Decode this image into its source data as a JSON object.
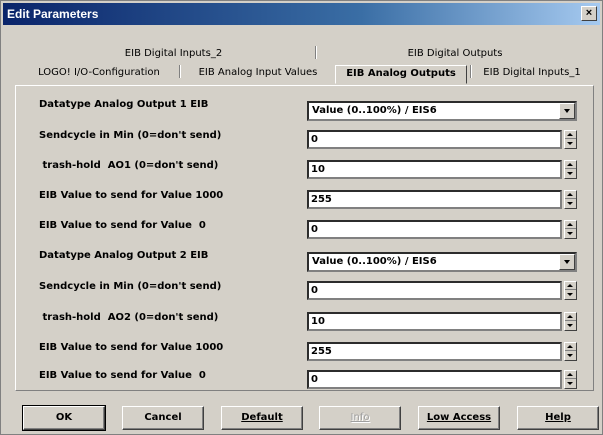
{
  "window": {
    "title": "Edit Parameters",
    "close_glyph": "×"
  },
  "tabs_back": [
    {
      "label": "EIB Digital Inputs_2"
    },
    {
      "label": "EIB Digital Outputs"
    }
  ],
  "tabs_front": [
    {
      "label": "LOGO! I/O-Configuration"
    },
    {
      "label": "EIB Analog Input Values"
    },
    {
      "label": "EIB Analog Outputs",
      "active": true
    },
    {
      "label": "EIB Digital Inputs_1"
    }
  ],
  "rows": [
    {
      "label": "Datatype Analog Output 1 EIB",
      "type": "select",
      "value": "Value (0..100%) / EIS6"
    },
    {
      "label": "Sendcycle in Min (0=don't send)",
      "type": "spin",
      "value": "0"
    },
    {
      "label": " trash-hold  AO1 (0=don't send)",
      "type": "spin",
      "value": "10"
    },
    {
      "label": "EIB Value to send for Value 1000",
      "type": "spin",
      "value": "255"
    },
    {
      "label": "EIB Value to send for Value  0",
      "type": "spin",
      "value": "0"
    },
    {
      "label": "Datatype Analog Output 2 EIB",
      "type": "select",
      "value": "Value (0..100%) / EIS6"
    },
    {
      "label": "Sendcycle in Min (0=don't send)",
      "type": "spin",
      "value": "0"
    },
    {
      "label": " trash-hold  AO2 (0=don't send)",
      "type": "spin",
      "value": "10"
    },
    {
      "label": "EIB Value to send for Value 1000",
      "type": "spin",
      "value": "255"
    },
    {
      "label": "EIB Value to send for Value  0",
      "type": "spin",
      "value": "0"
    }
  ],
  "buttons": {
    "ok": "OK",
    "cancel": "Cancel",
    "default": "Default",
    "info": "Info",
    "low_access": "Low Access",
    "help": "Help"
  }
}
